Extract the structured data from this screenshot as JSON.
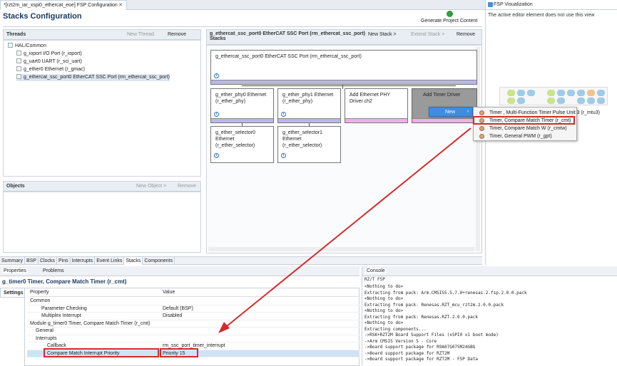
{
  "editor_tab": {
    "title": "*[rzt2m_iar_xspi0_ethercat_eoe] FSP Configuration",
    "close": "✕"
  },
  "visualization": {
    "tab_title": "FSP Visualization",
    "message": "The active editor element does not use this view"
  },
  "page": {
    "title": "Stacks Configuration",
    "generate_label": "Generate Project Content"
  },
  "threads": {
    "header": "Threads",
    "new_thread": "New Thread",
    "remove": "Remove",
    "root": "HAL/Common",
    "items": [
      "g_ioport I/O Port (r_ioport)",
      "g_uart0 UART (r_sci_uart)",
      "g_ether0 Ethernet (r_gmac)",
      "g_ethercat_ssc_port0 EtherCAT SSC Port (rm_ethercat_ssc_port)"
    ]
  },
  "objects": {
    "header": "Objects",
    "new_object": "New Object >",
    "remove": "Remove"
  },
  "stack": {
    "title": "g_ethercat_ssc_port0 EtherCAT SSC Port (rm_ethercat_ssc_port)",
    "subtitle": "Stacks",
    "new_stack": "New Stack >",
    "extend_stack": "Extend Stack >",
    "remove": "Remove",
    "top_card": "g_ethercat_ssc_port0 EtherCAT SSC Port (rm_ethercat_ssc_port)",
    "phy0": [
      "g_ether_phy0 Ethernet",
      "(r_ether_phy)"
    ],
    "phy1": [
      "g_ether_phy1 Ethernet",
      "(r_ether_phy)"
    ],
    "add_phy": [
      "Add Ethernet PHY",
      "Driver ch2"
    ],
    "add_timer": "Add Timer Driver",
    "sel0": [
      "g_ether_selector0",
      "Ethernet",
      "(r_ether_selector)"
    ],
    "sel1": [
      "g_ether_selector1",
      "Ethernet",
      "(r_ether_selector)"
    ]
  },
  "menu": {
    "new_label": "New",
    "items": [
      "Timer , Multi-Function Timer Pulse Unit 3 (r_mtu3)",
      "Timer, Compare Match Timer (r_cmt)",
      "Timer, Compare Match W (r_cmtw)",
      "Timer, General PWM (r_gpt)"
    ]
  },
  "bottom_tabs": [
    "Summary",
    "BSP",
    "Clocks",
    "Pins",
    "Interrupts",
    "Event Links",
    "Stacks",
    "Components"
  ],
  "properties": {
    "tab_properties": "Properties",
    "tab_problems": "Problems",
    "title": "g_timer0 Timer, Compare Match Timer (r_cmt)",
    "settings_tab": "Settings",
    "col_property": "Property",
    "col_value": "Value",
    "rows": [
      {
        "k": "Common",
        "v": ""
      },
      {
        "k": "Parameter Checking",
        "v": "Default (BSP)"
      },
      {
        "k": "Multiplex Interrupt",
        "v": "Disabled"
      },
      {
        "k": "Module g_timer0 Timer, Compare Match Timer (r_cmt)",
        "v": ""
      },
      {
        "k": "General",
        "v": ""
      },
      {
        "k": "Interrupts",
        "v": ""
      },
      {
        "k": "Callback",
        "v": "rm_ssc_port_timer_interrupt"
      },
      {
        "k": "Compare Match Interrupt Priority",
        "v": "Priority 15"
      }
    ]
  },
  "console": {
    "tab": "Console",
    "subtitle": "RZ/T FSP",
    "lines": [
      "<Nothing to do>",
      "Extracting from pack: Arm.CMSIS5.5.7.0+renesas.2.fsp.2.0.0.pack",
      "<Nothing to do>",
      "Extracting from pack: Renesas.RZT_mcu_rzt2m.2.0.0.pack",
      "<Nothing to do>",
      "Extracting from pack: Renesas.RZT.2.0.0.pack",
      "<Nothing to do>",
      "Extracting components...",
      "->RSK+RZT2M Board Support Files (xSPI0 x1 boot mode)",
      "->Arm CMSIS Version 5 - Core",
      "->Board support package for R9A07G075M24GBG",
      "->Board support package for RZT2M",
      "->Board support package for RZT2M - FSP Data"
    ]
  },
  "colors": {
    "accent_red": "#d52a2a",
    "header_blue": "#1c3a60",
    "menu_highlight": "#3a8ee6"
  }
}
